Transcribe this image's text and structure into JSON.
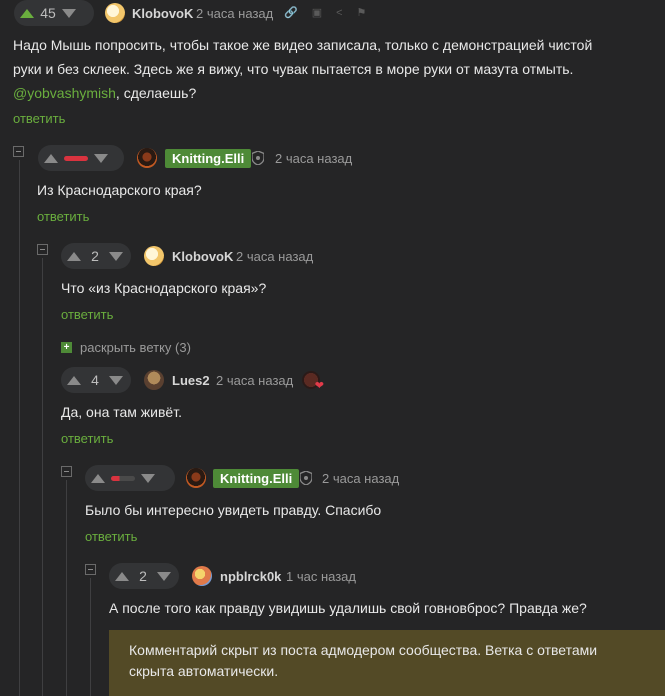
{
  "comments": [
    {
      "id": "c1",
      "votes": "45",
      "author": "KlobovoK",
      "time": "2 часа назад",
      "text_line1": "Надо Мышь попросить, чтобы такое же видео записала, только с демонстрацией чистой",
      "text_line2": "руки и без склеек. Здесь же я вижу, что чувак пытается в море руки от мазута отмыть.",
      "mention": "@yobvashymish",
      "text_line3_rest": ", сделаешь?",
      "reply": "ответить"
    },
    {
      "id": "c2",
      "author": "Knitting.Elli",
      "time": "2 часа назад",
      "text": "Из Краснодарского края?",
      "reply": "ответить"
    },
    {
      "id": "c3",
      "votes": "2",
      "author": "KlobovoK",
      "time": "2 часа назад",
      "text": "Что «из Краснодарского края»?",
      "reply": "ответить"
    },
    {
      "id": "c4",
      "votes": "4",
      "author": "Lues2",
      "time": "2 часа назад",
      "text": "Да, она там живёт.",
      "reply": "ответить"
    },
    {
      "id": "c5",
      "author": "Knitting.Elli",
      "time": "2 часа назад",
      "text": "Было бы интересно увидеть правду. Спасибо",
      "reply": "ответить"
    },
    {
      "id": "c6",
      "votes": "2",
      "author": "npblrck0k",
      "time": "1 час назад",
      "text": "А после того как правду увидишь удалишь свой говновброс? Правда же?"
    }
  ],
  "expand_thread": "раскрыть ветку (3)",
  "hidden_notice_line1": "Комментарий скрыт из поста адмодером сообщества. Ветка с ответами",
  "hidden_notice_line2": "скрыта автоматически.",
  "colors": {
    "accent": "#6aae3e",
    "badge": "#4e8a37",
    "negative": "#d9333f",
    "notice_bg": "#534a26"
  }
}
